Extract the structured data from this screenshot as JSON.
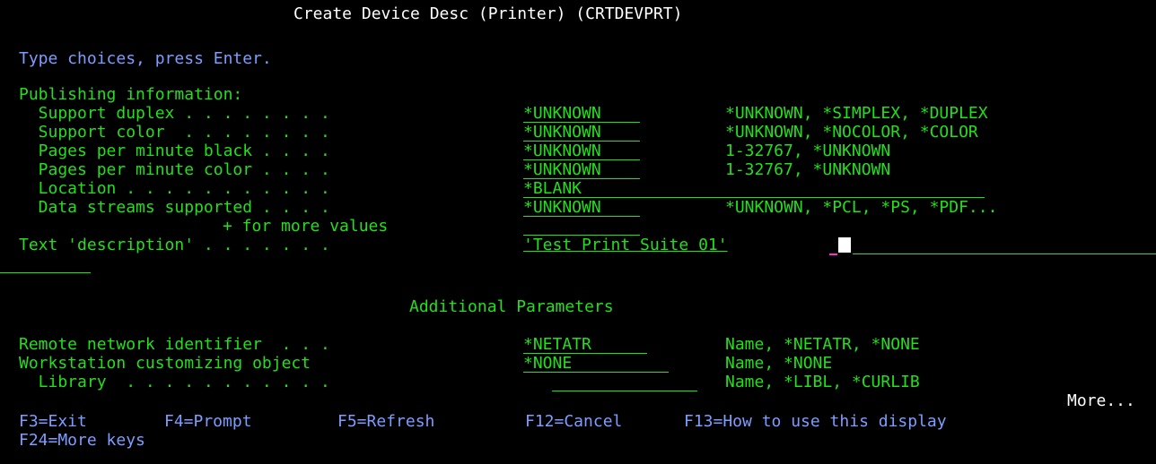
{
  "screen": {
    "title": "Create Device Desc (Printer) (CRTDEVPRT)",
    "instruction": "Type choices, press Enter.",
    "section_header": "Publishing information:",
    "params": [
      {
        "label": "  Support duplex . . . . . . . .",
        "value": "*UNKNOWN",
        "choices": "*UNKNOWN, *SIMPLEX, *DUPLEX"
      },
      {
        "label": "  Support color  . . . . . . . .",
        "value": "*UNKNOWN",
        "choices": "*UNKNOWN, *NOCOLOR, *COLOR"
      },
      {
        "label": "  Pages per minute black . . . .",
        "value": "*UNKNOWN",
        "choices": "1-32767, *UNKNOWN"
      },
      {
        "label": "  Pages per minute color . . . .",
        "value": "*UNKNOWN",
        "choices": "1-32767, *UNKNOWN"
      },
      {
        "label": "  Location . . . . . . . . . . .",
        "value": "*BLANK",
        "choices": ""
      },
      {
        "label": "  Data streams supported . . . .",
        "value": "*UNKNOWN",
        "choices": "*UNKNOWN, *PCL, *PS, *PDF..."
      }
    ],
    "more_values_label": "+ for more values",
    "text_description_label": "Text 'description' . . . . . . .",
    "text_description_value": "'Test Print Suite 01'",
    "additional_header": "Additional Parameters",
    "additional_params": [
      {
        "label": "Remote network identifier  . . .",
        "value": "*NETATR",
        "choices": "Name, *NETATR, *NONE"
      },
      {
        "label": "Workstation customizing object",
        "value": "*NONE",
        "choices": "Name, *NONE"
      },
      {
        "label": "  Library  . . . . . . . . . . .",
        "value": "",
        "choices": "Name, *LIBL, *CURLIB"
      }
    ],
    "more_indicator": "More...",
    "function_keys": [
      "F3=Exit",
      "F4=Prompt",
      "F5=Refresh",
      "F12=Cancel",
      "F13=How to use this display"
    ],
    "function_keys_line2": "F24=More keys"
  },
  "colors": {
    "background": "#000000",
    "text_green": "#22e01a",
    "text_blue": "#7d9dff",
    "text_white": "#ffffff",
    "cursor_mark": "#ff2bd6"
  }
}
